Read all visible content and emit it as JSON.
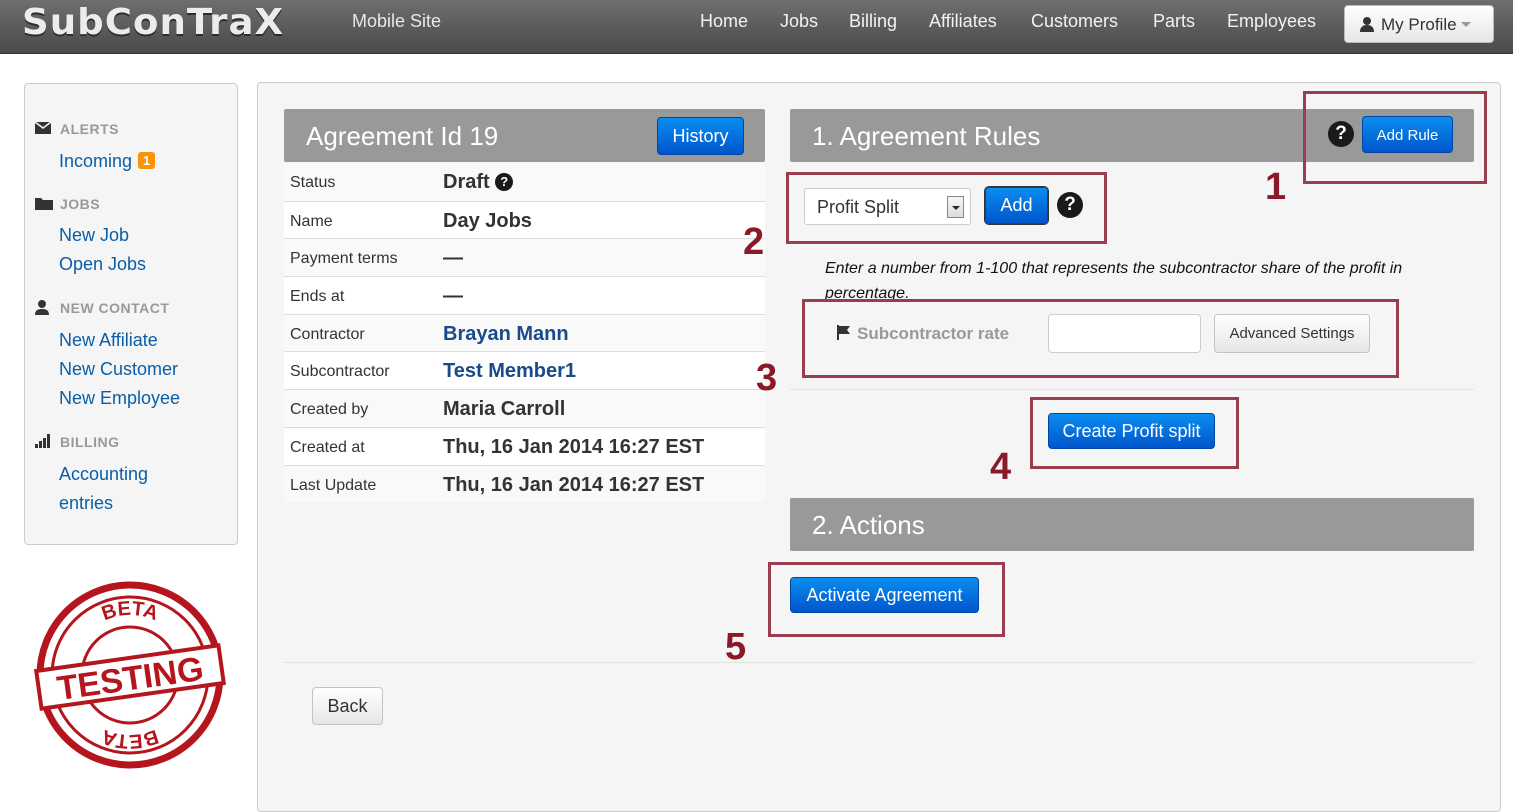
{
  "nav": {
    "brand": "SubConTraX",
    "mobile_site": "Mobile Site",
    "items": [
      "Home",
      "Jobs",
      "Billing",
      "Affiliates",
      "Customers",
      "Parts",
      "Employees"
    ],
    "profile": "My Profile"
  },
  "sidebar": {
    "alerts_heading": "ALERTS",
    "incoming": "Incoming",
    "incoming_count": "1",
    "jobs_heading": "JOBS",
    "new_job": "New Job",
    "open_jobs": "Open Jobs",
    "contact_heading": "NEW CONTACT",
    "new_affiliate": "New Affiliate",
    "new_customer": "New Customer",
    "new_employee": "New Employee",
    "billing_heading": "BILLING",
    "accounting_line1": "Accounting",
    "accounting_line2": "entries"
  },
  "stamp": {
    "top": "BETA",
    "middle": "TESTING",
    "bottom": "BETA"
  },
  "agreement": {
    "title": "Agreement Id 19",
    "history_button": "History",
    "rows": [
      {
        "label": "Status",
        "value": "Draft"
      },
      {
        "label": "Name",
        "value": "Day Jobs"
      },
      {
        "label": "Payment terms",
        "value": "—"
      },
      {
        "label": "Ends at",
        "value": "—"
      },
      {
        "label": "Contractor",
        "value": "Brayan Mann"
      },
      {
        "label": "Subcontractor",
        "value": "Test Member1"
      },
      {
        "label": "Created by",
        "value": "Maria Carroll"
      },
      {
        "label": "Created at",
        "value": "Thu, 16 Jan 2014 16:27 EST"
      },
      {
        "label": "Last Update",
        "value": "Thu, 16 Jan 2014 16:27 EST"
      }
    ]
  },
  "rules": {
    "title": "1. Agreement Rules",
    "add_rule_button": "Add Rule",
    "rule_type": "Profit Split",
    "add_button": "Add",
    "help_text": "Enter a number from 1-100 that represents the subcontractor share of the profit in percentage.",
    "rate_label": "Subcontractor rate",
    "rate_value": "",
    "advanced_button": "Advanced Settings",
    "create_button": "Create Profit split"
  },
  "actions": {
    "title": "2. Actions",
    "activate_button": "Activate Agreement"
  },
  "back_button": "Back",
  "annotations": [
    "1",
    "2",
    "3",
    "4",
    "5"
  ]
}
